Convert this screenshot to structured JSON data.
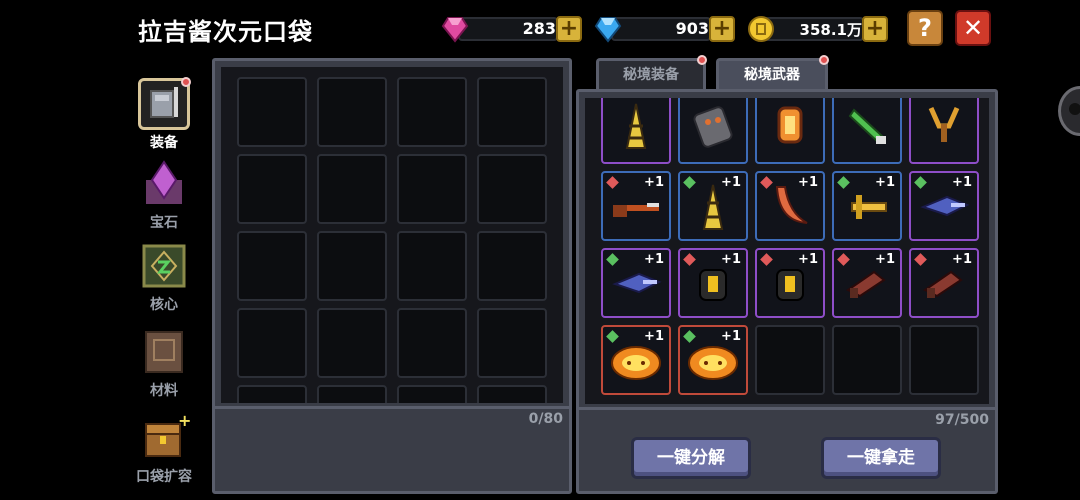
{
  "header": {
    "title": "拉吉酱次元口袋",
    "resources": [
      {
        "name": "pink-gem",
        "value": "283",
        "color": "#e04aa0"
      },
      {
        "name": "blue-gem",
        "value": "903",
        "color": "#3aa8f0"
      },
      {
        "name": "gold-coin",
        "value": "358.1万",
        "color": "#f2c830"
      }
    ],
    "plus_label": "+",
    "help_label": "?",
    "close_label": "✕"
  },
  "sidebar": {
    "items": [
      {
        "label": "装备",
        "icon": "armor-icon"
      },
      {
        "label": "宝石",
        "icon": "gem-icon"
      },
      {
        "label": "核心",
        "icon": "core-icon"
      },
      {
        "label": "材料",
        "icon": "material-icon"
      },
      {
        "label": "口袋扩容",
        "icon": "chest-icon"
      }
    ]
  },
  "left_panel": {
    "count": "0/80"
  },
  "tabs": [
    {
      "label": "秘境装备",
      "active": false
    },
    {
      "label": "秘境武器",
      "active": true
    }
  ],
  "right_panel": {
    "count": "97/500",
    "items": [
      {
        "icon": "drill-cone-icon",
        "rarity": "purple",
        "plus": ""
      },
      {
        "icon": "stone-golem-icon",
        "rarity": "blue",
        "plus": ""
      },
      {
        "icon": "lantern-icon",
        "rarity": "blue",
        "plus": ""
      },
      {
        "icon": "green-blade-icon",
        "rarity": "blue",
        "plus": ""
      },
      {
        "icon": "slingshot-icon",
        "rarity": "purple",
        "plus": ""
      },
      {
        "icon": "rifle-icon",
        "rarity": "blue",
        "plus": "+1",
        "gem": "red"
      },
      {
        "icon": "drill-cone-icon",
        "rarity": "blue",
        "plus": "+1",
        "gem": "green"
      },
      {
        "icon": "boomerang-icon",
        "rarity": "blue",
        "plus": "+1",
        "gem": "red"
      },
      {
        "icon": "golden-sword-icon",
        "rarity": "blue",
        "plus": "+1",
        "gem": "green"
      },
      {
        "icon": "fish-gun-icon",
        "rarity": "purple",
        "plus": "+1",
        "gem": "green"
      },
      {
        "icon": "fish-gun-icon",
        "rarity": "purple",
        "plus": "+1",
        "gem": "green"
      },
      {
        "icon": "lantern-bug-icon",
        "rarity": "purple",
        "plus": "+1",
        "gem": "red"
      },
      {
        "icon": "lantern-bug-icon",
        "rarity": "purple",
        "plus": "+1",
        "gem": "red"
      },
      {
        "icon": "crossbow-icon",
        "rarity": "purple",
        "plus": "+1",
        "gem": "red"
      },
      {
        "icon": "crossbow-icon",
        "rarity": "purple",
        "plus": "+1",
        "gem": "red"
      },
      {
        "icon": "flame-lotus-icon",
        "rarity": "red",
        "plus": "+1",
        "gem": "green"
      },
      {
        "icon": "flame-lotus-icon",
        "rarity": "red",
        "plus": "+1",
        "gem": "green"
      }
    ]
  },
  "actions": {
    "dismantle_label": "一键分解",
    "take_label": "一键拿走"
  }
}
